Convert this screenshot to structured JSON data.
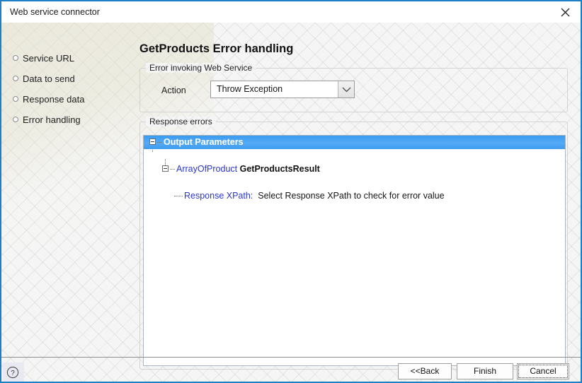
{
  "window": {
    "title": "Web service connector",
    "close_icon": "close-icon",
    "accent_color": "#1f7fc4"
  },
  "sidebar": {
    "items": [
      {
        "label": "Service URL",
        "bullet_icon": "step-bullet-icon"
      },
      {
        "label": "Data to send",
        "bullet_icon": "step-bullet-icon"
      },
      {
        "label": "Response data",
        "bullet_icon": "step-bullet-icon"
      },
      {
        "label": "Error handling",
        "bullet_icon": "step-bullet-icon"
      }
    ]
  },
  "main": {
    "page_title": "GetProducts Error handling",
    "error_group": {
      "legend": "Error invoking Web Service",
      "action_label": "Action",
      "action_value": "Throw Exception",
      "dropdown_icon": "chevron-down-icon"
    },
    "response_group": {
      "legend": "Response errors",
      "tree": {
        "rows": [
          {
            "label": "Output Parameters",
            "selected": true,
            "toggle_icon": "collapse-minus-icon"
          },
          {
            "type_name": "ArrayOfProduct",
            "label": "GetProductsResult",
            "selected": false,
            "toggle_icon": "collapse-minus-icon"
          },
          {
            "field_label": "Response XPath:",
            "value_text": "Select Response XPath to check for error value",
            "selected": false
          }
        ],
        "selection_color": "#3d9bef"
      }
    }
  },
  "footer": {
    "help_icon": "help-question-icon",
    "back_label": "<<Back",
    "finish_label": "Finish",
    "cancel_label": "Cancel"
  }
}
